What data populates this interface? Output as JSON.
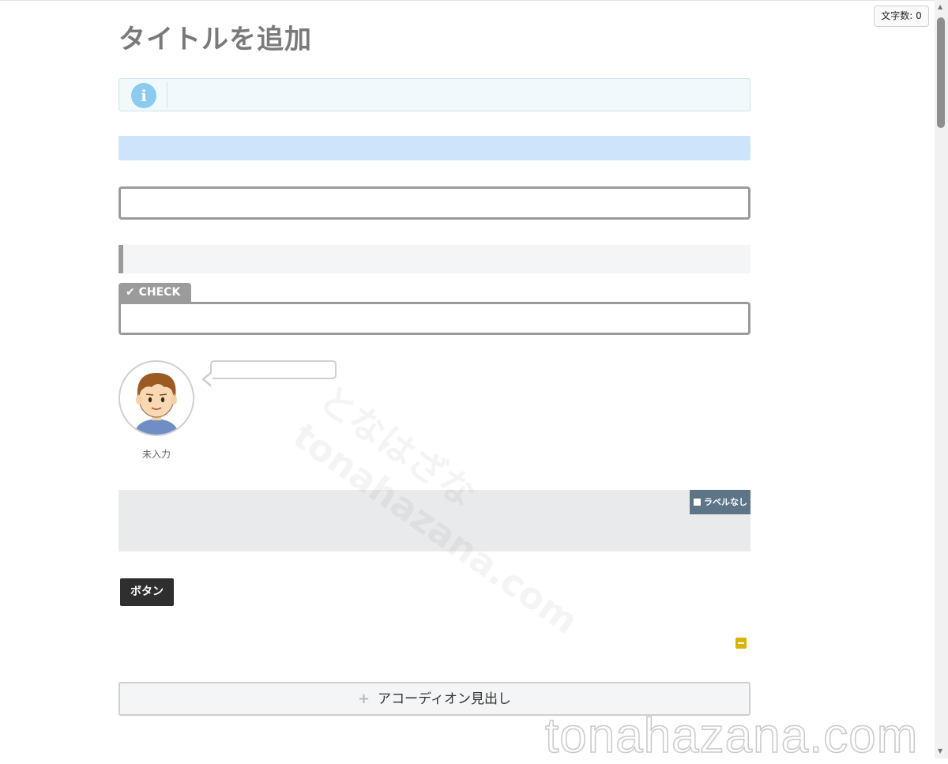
{
  "toolbar": {
    "word_count_label": "文字数: 0"
  },
  "editor": {
    "title_placeholder": "タイトルを追加",
    "info_icon": "info-icon",
    "check_label": "CHECK",
    "check_icon": "checkmark-icon",
    "speech": {
      "avatar_name": "未入力",
      "avatar_icon": "boy-avatar-icon"
    },
    "labelbox": {
      "label": "ラベルなし"
    },
    "button_label": "ボタン",
    "accordion": {
      "plus_icon": "plus-icon",
      "heading": "アコーディオン見出し"
    },
    "colors": {
      "info_bg": "#f0fafc",
      "info_icon": "#8acbef",
      "blue_bar": "#cde5fb",
      "border_gray": "#9b9b9b",
      "label_badge": "#5d7587",
      "button_bg": "#2f2f2f",
      "toggle_yellow": "#d8b400"
    }
  },
  "watermark": {
    "text": "tonahazana.com",
    "text_jp": "となはざな"
  }
}
